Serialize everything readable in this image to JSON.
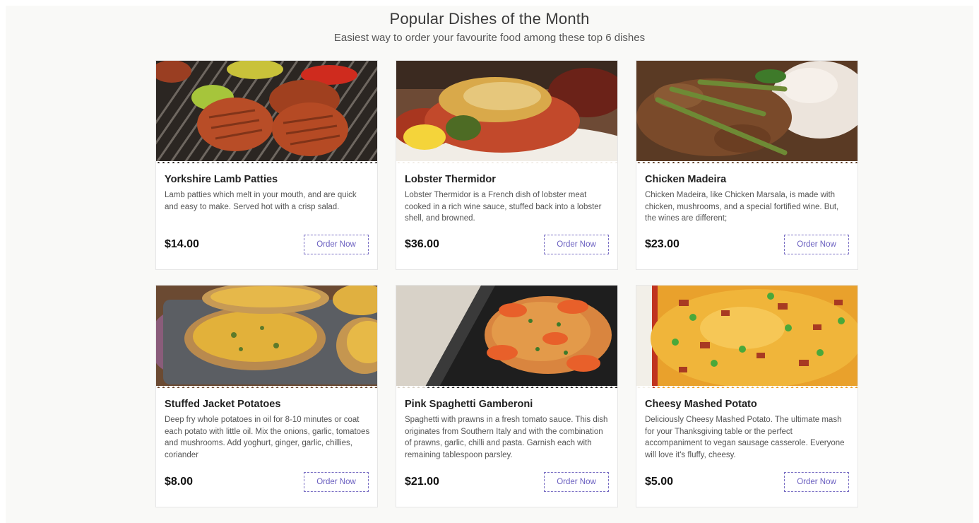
{
  "header": {
    "title": "Popular Dishes of the Month",
    "subtitle": "Easiest way to order your favourite food among these top 6 dishes"
  },
  "colors": {
    "accent": "#6a5fc0",
    "background": "#f9f9f7"
  },
  "dishes": [
    {
      "name": "Yorkshire Lamb Patties",
      "description": "Lamb patties which melt in your mouth, and are quick and easy to make. Served hot with a crisp salad.",
      "price": "$14.00",
      "order_label": "Order Now"
    },
    {
      "name": "Lobster Thermidor",
      "description": "Lobster Thermidor is a French dish of lobster meat cooked in a rich wine sauce, stuffed back into a lobster shell, and browned.",
      "price": "$36.00",
      "order_label": "Order Now"
    },
    {
      "name": "Chicken Madeira",
      "description": "Chicken Madeira, like Chicken Marsala, is made with chicken, mushrooms, and a special fortified wine. But, the wines are different;",
      "price": "$23.00",
      "order_label": "Order Now"
    },
    {
      "name": "Stuffed Jacket Potatoes",
      "description": "Deep fry whole potatoes in oil for 8-10 minutes or coat each potato with little oil. Mix the onions, garlic, tomatoes and mushrooms. Add yoghurt, ginger, garlic, chillies, coriander",
      "price": "$8.00",
      "order_label": "Order Now"
    },
    {
      "name": "Pink Spaghetti Gamberoni",
      "description": "Spaghetti with prawns in a fresh tomato sauce. This dish originates from Southern Italy and with the combination of prawns, garlic, chilli and pasta. Garnish each with remaining tablespoon parsley.",
      "price": "$21.00",
      "order_label": "Order Now"
    },
    {
      "name": "Cheesy Mashed Potato",
      "description": "Deliciously Cheesy Mashed Potato. The ultimate mash for your Thanksgiving table or the perfect accompaniment to vegan sausage casserole. Everyone will love it's fluffy, cheesy.",
      "price": "$5.00",
      "order_label": "Order Now"
    }
  ]
}
